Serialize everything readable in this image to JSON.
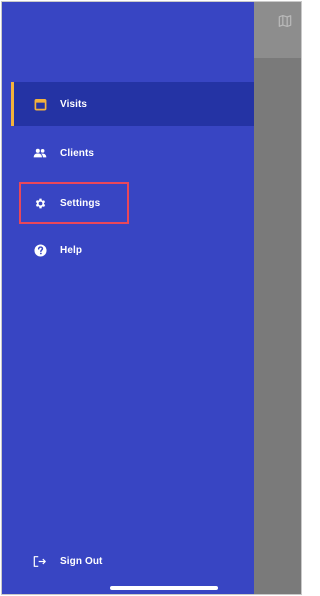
{
  "drawer": {
    "items": [
      {
        "label": "Visits",
        "icon": "calendar-icon",
        "active": true
      },
      {
        "label": "Clients",
        "icon": "people-icon",
        "active": false
      },
      {
        "label": "Settings",
        "icon": "gear-icon",
        "active": false,
        "highlighted": true
      },
      {
        "label": "Help",
        "icon": "help-circle-icon",
        "active": false
      }
    ],
    "sign_out_label": "Sign Out",
    "sign_out_icon": "sign-out-icon"
  },
  "backdrop": {
    "header_icon": "map-icon"
  },
  "colors": {
    "drawer_background": "#3845c3",
    "active_item_background": "#2433a4",
    "active_indicator": "#f3b23d",
    "calendar_icon": "#f3b23d",
    "highlight_box": "#e9475a",
    "backdrop": "#7a7a7a"
  }
}
